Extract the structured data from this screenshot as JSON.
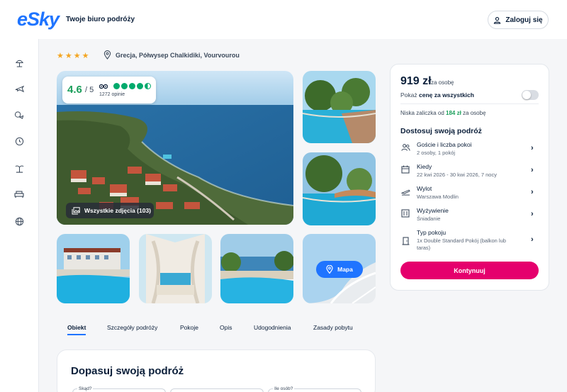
{
  "header": {
    "logo": "eSky",
    "tagline": "Twoje biuro podróży",
    "login_label": "Zaloguj się"
  },
  "sidebar": {
    "items": [
      {
        "icon": "beach-umbrella-icon"
      },
      {
        "icon": "plane-icon"
      },
      {
        "icon": "plane-hotel-icon"
      },
      {
        "icon": "clock-icon"
      },
      {
        "icon": "island-icon"
      },
      {
        "icon": "bed-icon"
      },
      {
        "icon": "globe-icon"
      }
    ]
  },
  "hotel": {
    "stars": "★★★★",
    "location": "Grecja, Półwysep Chalkidiki, Vourvourou"
  },
  "rating": {
    "score": "4.6",
    "out_of": "/ 5",
    "reviews": "1272 opinie",
    "dots_filled": 4.5
  },
  "gallery": {
    "all_photos_label": "Wszystkie zdjęcia (103)",
    "map_label": "Mapa"
  },
  "tabs": [
    {
      "label": "Obiekt",
      "active": true
    },
    {
      "label": "Szczegóły podróży",
      "active": false
    },
    {
      "label": "Pokoje",
      "active": false
    },
    {
      "label": "Opis",
      "active": false
    },
    {
      "label": "Udogodnienia",
      "active": false
    },
    {
      "label": "Zasady pobytu",
      "active": false
    }
  ],
  "customize": {
    "title": "Dopasuj swoją podróż",
    "field_from": "Skąd?",
    "field_people": "Ile osób?"
  },
  "booking": {
    "price": "919 zł",
    "price_per": "za osobę",
    "toggle_text_pre": "Pokaż ",
    "toggle_text_bold": "cenę za wszystkich",
    "deposit_pre": "Niska zaliczka od ",
    "deposit_amount": "184 zł",
    "deposit_post": " za osobę",
    "section_title": "Dostosuj swoją podróż",
    "options": [
      {
        "icon": "guests-icon",
        "title": "Goście i liczba pokoi",
        "sub": "2 osoby, 1 pokój"
      },
      {
        "icon": "calendar-icon",
        "title": "Kiedy",
        "sub": "22 kwi 2026 - 30 kwi 2026, 7 nocy"
      },
      {
        "icon": "takeoff-icon",
        "title": "Wylot",
        "sub": "Warszawa Modlin"
      },
      {
        "icon": "meal-icon",
        "title": "Wyżywienie",
        "sub": "Śniadanie"
      },
      {
        "icon": "door-icon",
        "title": "Typ pokoju",
        "sub": "1x Double Standard Pokój (balkon lub taras)"
      }
    ],
    "cta_label": "Kontynuuj"
  },
  "colors": {
    "brand_blue": "#1f74ff",
    "cta_pink": "#e5006d",
    "rating_green": "#1a9e5a",
    "star_orange": "#f4a623"
  }
}
